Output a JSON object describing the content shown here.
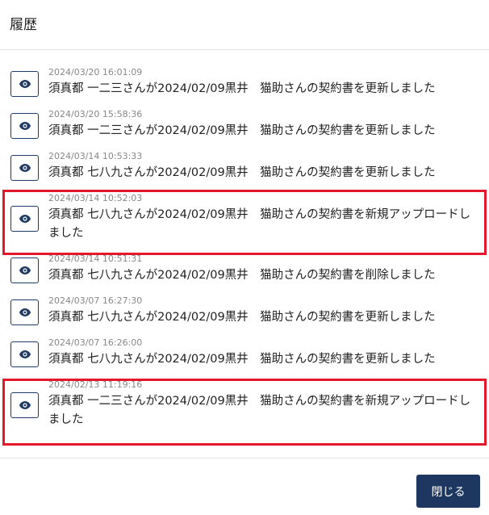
{
  "dialog": {
    "title": "履歴",
    "close_label": "閉じる"
  },
  "icons": {
    "view": "eye-icon"
  },
  "colors": {
    "highlight": "#e3182a",
    "button": "#1e3760"
  },
  "entries": [
    {
      "timestamp": "2024/03/20 16:01:09",
      "message": "須真都 一二三さんが2024/02/09黒井　猫助さんの契約書を更新しました",
      "highlighted": false
    },
    {
      "timestamp": "2024/03/20 15:58:36",
      "message": "須真都 一二三さんが2024/02/09黒井　猫助さんの契約書を更新しました",
      "highlighted": false
    },
    {
      "timestamp": "2024/03/14 10:53:33",
      "message": "須真都 七八九さんが2024/02/09黒井　猫助さんの契約書を更新しました",
      "highlighted": false
    },
    {
      "timestamp": "2024/03/14 10:52:03",
      "message": "須真都 七八九さんが2024/02/09黒井　猫助さんの契約書を新規アップロードしました",
      "highlighted": true
    },
    {
      "timestamp": "2024/03/14 10:51:31",
      "message": "須真都 七八九さんが2024/02/09黒井　猫助さんの契約書を削除しました",
      "highlighted": false
    },
    {
      "timestamp": "2024/03/07 16:27:30",
      "message": "須真都 七八九さんが2024/02/09黒井　猫助さんの契約書を更新しました",
      "highlighted": false
    },
    {
      "timestamp": "2024/03/07 16:26:00",
      "message": "須真都 七八九さんが2024/02/09黒井　猫助さんの契約書を更新しました",
      "highlighted": false
    },
    {
      "timestamp": "2024/02/13 11:19:16",
      "message": "須真都 一二三さんが2024/02/09黒井　猫助さんの契約書を新規アップロードしました",
      "highlighted": true
    }
  ]
}
